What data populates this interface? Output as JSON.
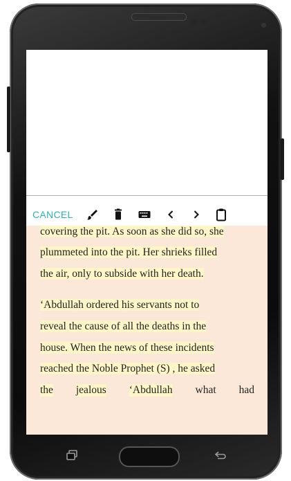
{
  "toolbar": {
    "cancel_label": "CANCEL",
    "icons": [
      "brush-icon",
      "delete-icon",
      "keyboard-icon",
      "chevron-left-icon",
      "chevron-right-icon",
      "clipboard-icon"
    ]
  },
  "reading": {
    "lines": [
      "covering the pit. As soon as she did so, she",
      "plummeted into the pit. Her shrieks filled",
      "the air, only to subside with her death.",
      "‘Abdullah ordered his servants not to",
      "reveal the cause of all the deaths in the",
      "house. When the news of these incidents",
      "reached the Noble Prophet (S) , he asked",
      "the jealous ‘Abdullah what had"
    ],
    "last_line_words": [
      "the",
      "jealous",
      "‘Abdullah",
      "what",
      "had"
    ]
  },
  "navbar": {
    "icons": [
      "recent-apps-icon",
      "home-button",
      "back-icon"
    ]
  },
  "colors": {
    "accent": "#2bb3b3",
    "reading_background": "#fce8d8",
    "highlight": "#fff6c8"
  }
}
